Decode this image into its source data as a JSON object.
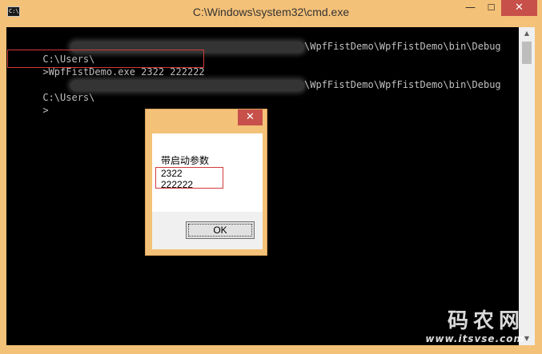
{
  "window": {
    "title": "C:\\Windows\\system32\\cmd.exe",
    "icon_text": "C:\\",
    "minimize_glyph": "—",
    "maximize_glyph": "☐",
    "close_glyph": "✕"
  },
  "console": {
    "lines": [
      {
        "prefix": "C:\\Users\\",
        "suffix": "\\WpfFistDemo\\WpfFistDemo\\bin\\Debug"
      },
      {
        "text": ">WpfFistDemo.exe 2322 222222"
      },
      {
        "prefix": "C:\\Users\\",
        "suffix": "\\WpfFistDemo\\WpfFistDemo\\bin\\Debug"
      },
      {
        "text": ">"
      }
    ],
    "scroll_up_glyph": "▲",
    "scroll_down_glyph": "▼"
  },
  "dialog": {
    "close_glyph": "✕",
    "message": [
      "带启动参数",
      "2322",
      "222222"
    ],
    "ok_label": "OK"
  },
  "watermark": {
    "main": "码农网",
    "url": "www.itsvse.com"
  },
  "colors": {
    "frame": "#f4c178",
    "close_button": "#c7504a",
    "console_bg": "#000000",
    "console_text": "#c0c0c0",
    "highlight_box": "#d23a3a"
  }
}
